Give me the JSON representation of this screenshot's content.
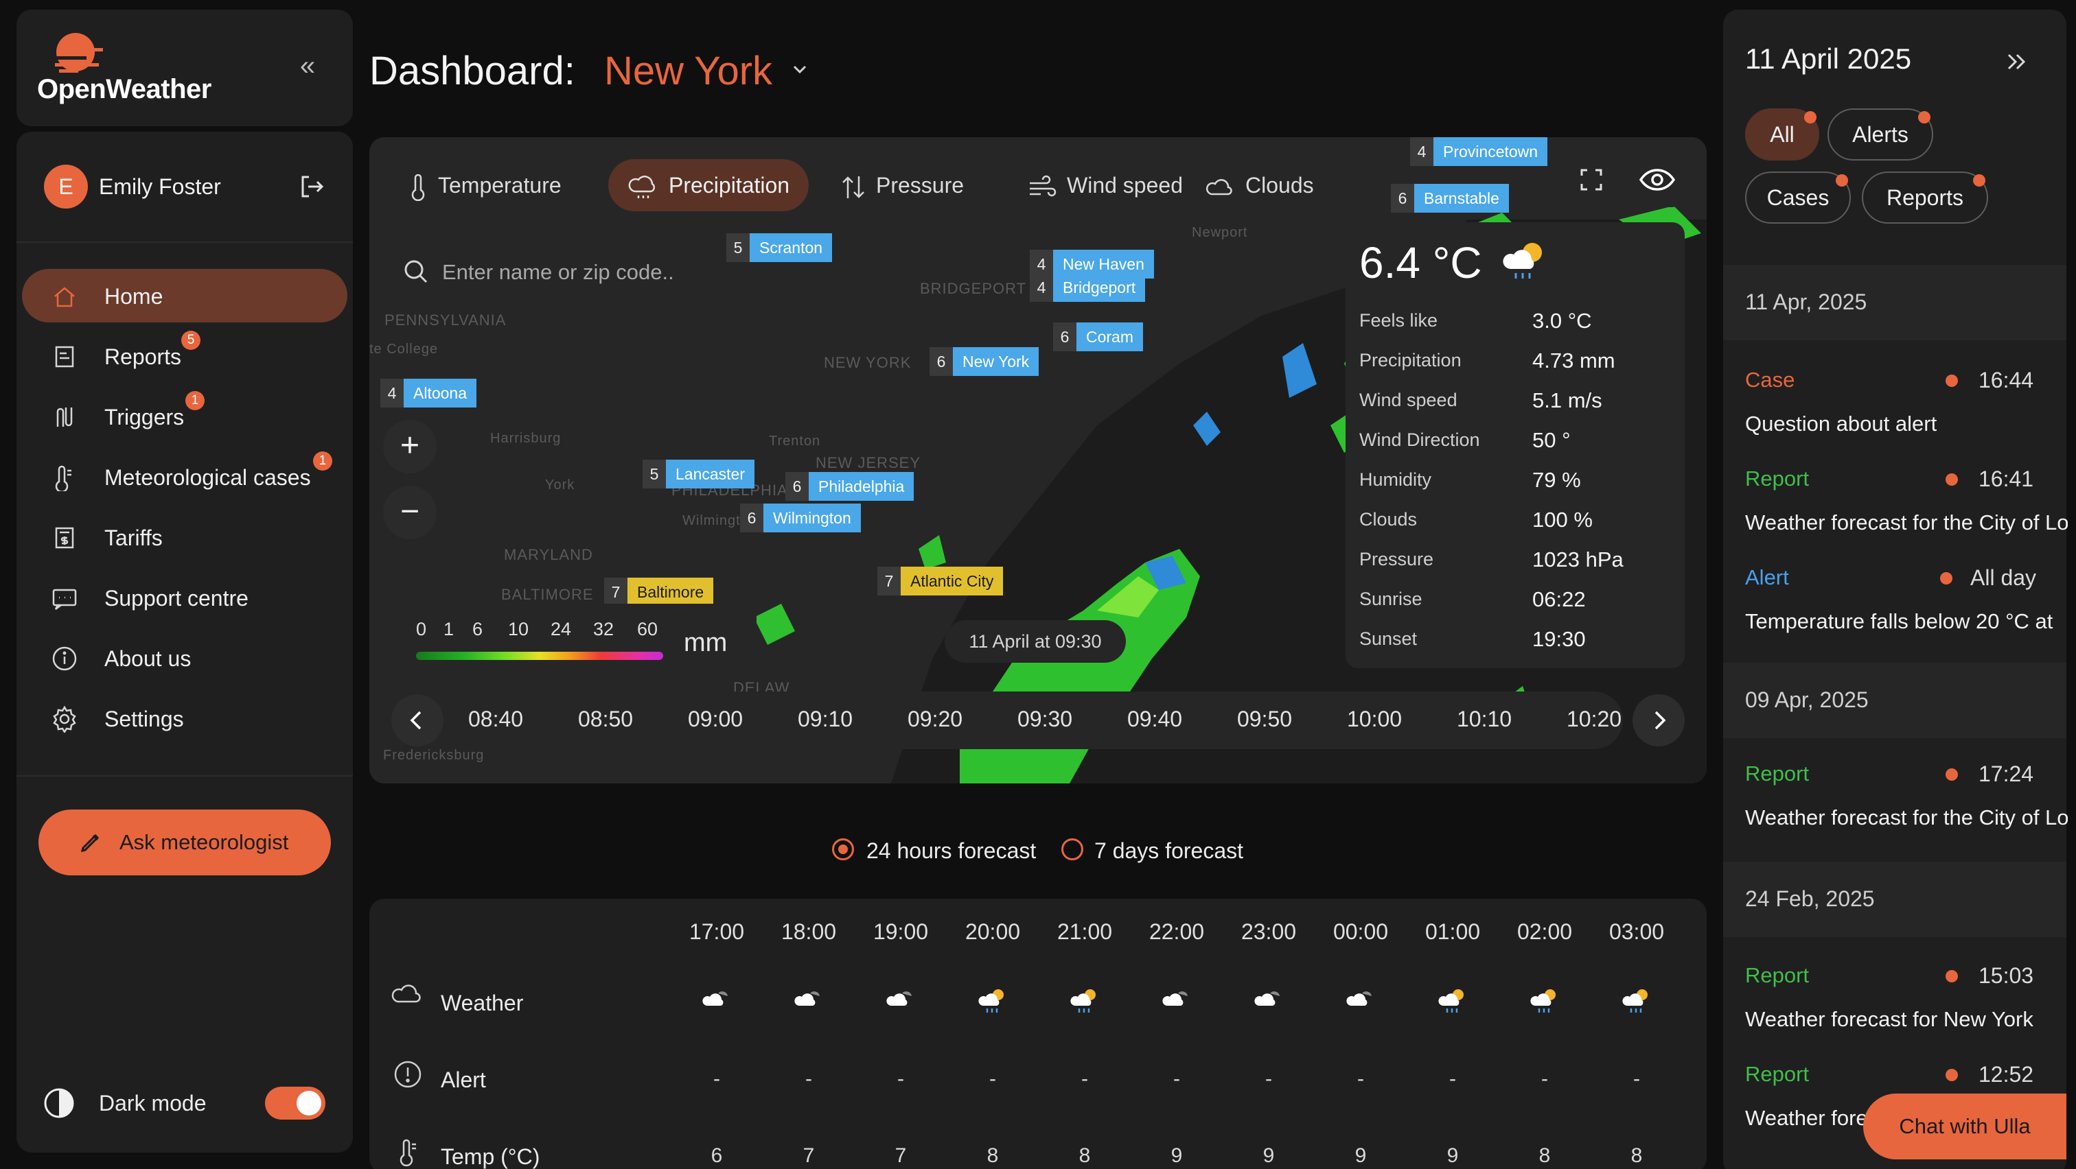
{
  "app": {
    "brand": "OpenWeather",
    "accent_color": "#e8663d"
  },
  "sidebar": {
    "user": {
      "initial": "E",
      "name": "Emily Foster"
    },
    "items": [
      {
        "label": "Home",
        "icon": "home-icon",
        "active": true,
        "badge": null
      },
      {
        "label": "Reports",
        "icon": "reports-icon",
        "active": false,
        "badge": "5"
      },
      {
        "label": "Triggers",
        "icon": "triggers-icon",
        "active": false,
        "badge": "1"
      },
      {
        "label": "Meteorological cases",
        "icon": "thermometer-icon",
        "active": false,
        "badge": "1"
      },
      {
        "label": "Tariffs",
        "icon": "tariffs-icon",
        "active": false,
        "badge": null
      },
      {
        "label": "Support centre",
        "icon": "chat-icon",
        "active": false,
        "badge": null
      },
      {
        "label": "About us",
        "icon": "info-icon",
        "active": false,
        "badge": null
      },
      {
        "label": "Settings",
        "icon": "gear-icon",
        "active": false,
        "badge": null
      }
    ],
    "ask_button": "Ask meteorologist",
    "dark_mode_label": "Dark mode",
    "dark_mode_on": true
  },
  "header": {
    "title": "Dashboard:",
    "city": "New York"
  },
  "map": {
    "layers": [
      {
        "label": "Temperature",
        "icon": "thermometer-icon",
        "active": false
      },
      {
        "label": "Precipitation",
        "icon": "cloud-rain-icon",
        "active": true
      },
      {
        "label": "Pressure",
        "icon": "pressure-arrows-icon",
        "active": false
      },
      {
        "label": "Wind speed",
        "icon": "wind-icon",
        "active": false
      },
      {
        "label": "Clouds",
        "icon": "cloud-icon",
        "active": false
      }
    ],
    "search_placeholder": "Enter name or zip code..",
    "zoom_in": "+",
    "zoom_out": "−",
    "region_labels": [
      "PENNSYLVANIA",
      "NEW YORK",
      "NEW JERSEY",
      "MARYLAND",
      "BALTIMORE",
      "BRIDGEPORT",
      "PHILADELPHIA",
      "DELAW"
    ],
    "minor_labels": [
      "Harrisburg",
      "York",
      "Trenton",
      "Wilmington",
      "Newport",
      "Fredericksburg",
      "te College"
    ],
    "cities": [
      {
        "num": "5",
        "name": "Scranton",
        "color": "blue"
      },
      {
        "num": "4",
        "name": "New Haven",
        "color": "blue"
      },
      {
        "num": "4",
        "name": "Bridgeport",
        "color": "blue"
      },
      {
        "num": "6",
        "name": "Coram",
        "color": "blue"
      },
      {
        "num": "6",
        "name": "New York",
        "color": "blue"
      },
      {
        "num": "4",
        "name": "Altoona",
        "color": "blue"
      },
      {
        "num": "5",
        "name": "Lancaster",
        "color": "blue"
      },
      {
        "num": "6",
        "name": "Philadelphia",
        "color": "blue"
      },
      {
        "num": "6",
        "name": "Wilmington",
        "color": "blue"
      },
      {
        "num": "7",
        "name": "Atlantic City",
        "color": "yellow"
      },
      {
        "num": "7",
        "name": "Baltimore",
        "color": "yellow"
      },
      {
        "num": "6",
        "name": "Barnstable",
        "color": "blue"
      },
      {
        "num": "4",
        "name": "Provincetown",
        "color": "blue"
      }
    ],
    "detail": {
      "temperature": "6.4 °C",
      "weather_icon": "cloud-sun-rain-icon",
      "rows": [
        {
          "label": "Feels like",
          "value": "3.0 °C"
        },
        {
          "label": "Precipitation",
          "value": "4.73 mm"
        },
        {
          "label": "Wind speed",
          "value": "5.1 m/s"
        },
        {
          "label": "Wind Direction",
          "value": "50 °"
        },
        {
          "label": "Humidity",
          "value": "79 %"
        },
        {
          "label": "Clouds",
          "value": "100 %"
        },
        {
          "label": "Pressure",
          "value": "1023 hPa"
        },
        {
          "label": "Sunrise",
          "value": "06:22"
        },
        {
          "label": "Sunset",
          "value": "19:30"
        }
      ]
    },
    "legend": {
      "ticks": [
        "0",
        "1",
        "6",
        "10",
        "24",
        "32",
        "60"
      ],
      "unit": "mm"
    },
    "time_label": "11 April at 09:30",
    "timeline": [
      "08:40",
      "08:50",
      "09:00",
      "09:10",
      "09:20",
      "09:30",
      "09:40",
      "09:50",
      "10:00",
      "10:10",
      "10:20"
    ]
  },
  "forecast": {
    "options": [
      {
        "label": "24 hours forecast",
        "selected": true
      },
      {
        "label": "7 days forecast",
        "selected": false
      }
    ],
    "hours": [
      "17:00",
      "18:00",
      "19:00",
      "20:00",
      "21:00",
      "22:00",
      "23:00",
      "00:00",
      "01:00",
      "02:00",
      "03:00"
    ],
    "rows": [
      {
        "label": "Weather",
        "icon": "cloud-icon"
      },
      {
        "label": "Alert",
        "icon": "alert-circle-icon"
      },
      {
        "label": "Temp (°C)",
        "icon": "thermometer-icon"
      }
    ],
    "weather": [
      "cloudy",
      "cloudy",
      "cloudy",
      "sun-rain",
      "sun-rain",
      "cloudy",
      "cloudy",
      "cloudy",
      "sun-rain",
      "sun-rain",
      "sun-rain"
    ],
    "alerts": [
      "-",
      "-",
      "-",
      "-",
      "-",
      "-",
      "-",
      "-",
      "-",
      "-",
      "-"
    ],
    "temps": [
      "6",
      "7",
      "7",
      "8",
      "8",
      "9",
      "9",
      "9",
      "9",
      "8",
      "8"
    ]
  },
  "right_panel": {
    "date": "11 April 2025",
    "filters": [
      {
        "label": "All",
        "active": true
      },
      {
        "label": "Alerts",
        "active": false
      },
      {
        "label": "Cases",
        "active": false
      },
      {
        "label": "Reports",
        "active": false
      }
    ],
    "groups": [
      {
        "date": "11 Apr, 2025",
        "entries": [
          {
            "type": "Case",
            "kind": "case",
            "time": "16:44",
            "text": "Question about alert"
          },
          {
            "type": "Report",
            "kind": "report",
            "time": "16:41",
            "text": "Weather forecast for the City of London"
          },
          {
            "type": "Alert",
            "kind": "alert",
            "time": "All day",
            "text": "Temperature falls below 20 °C at"
          }
        ]
      },
      {
        "date": "09 Apr, 2025",
        "entries": [
          {
            "type": "Report",
            "kind": "report",
            "time": "17:24",
            "text": "Weather forecast for the City of London"
          }
        ]
      },
      {
        "date": "24 Feb, 2025",
        "entries": [
          {
            "type": "Report",
            "kind": "report",
            "time": "15:03",
            "text": "Weather forecast for New York"
          },
          {
            "type": "Report",
            "kind": "report",
            "time": "12:52",
            "text": "Weather forecast for"
          }
        ]
      }
    ],
    "chat_button": "Chat with Ulla"
  }
}
